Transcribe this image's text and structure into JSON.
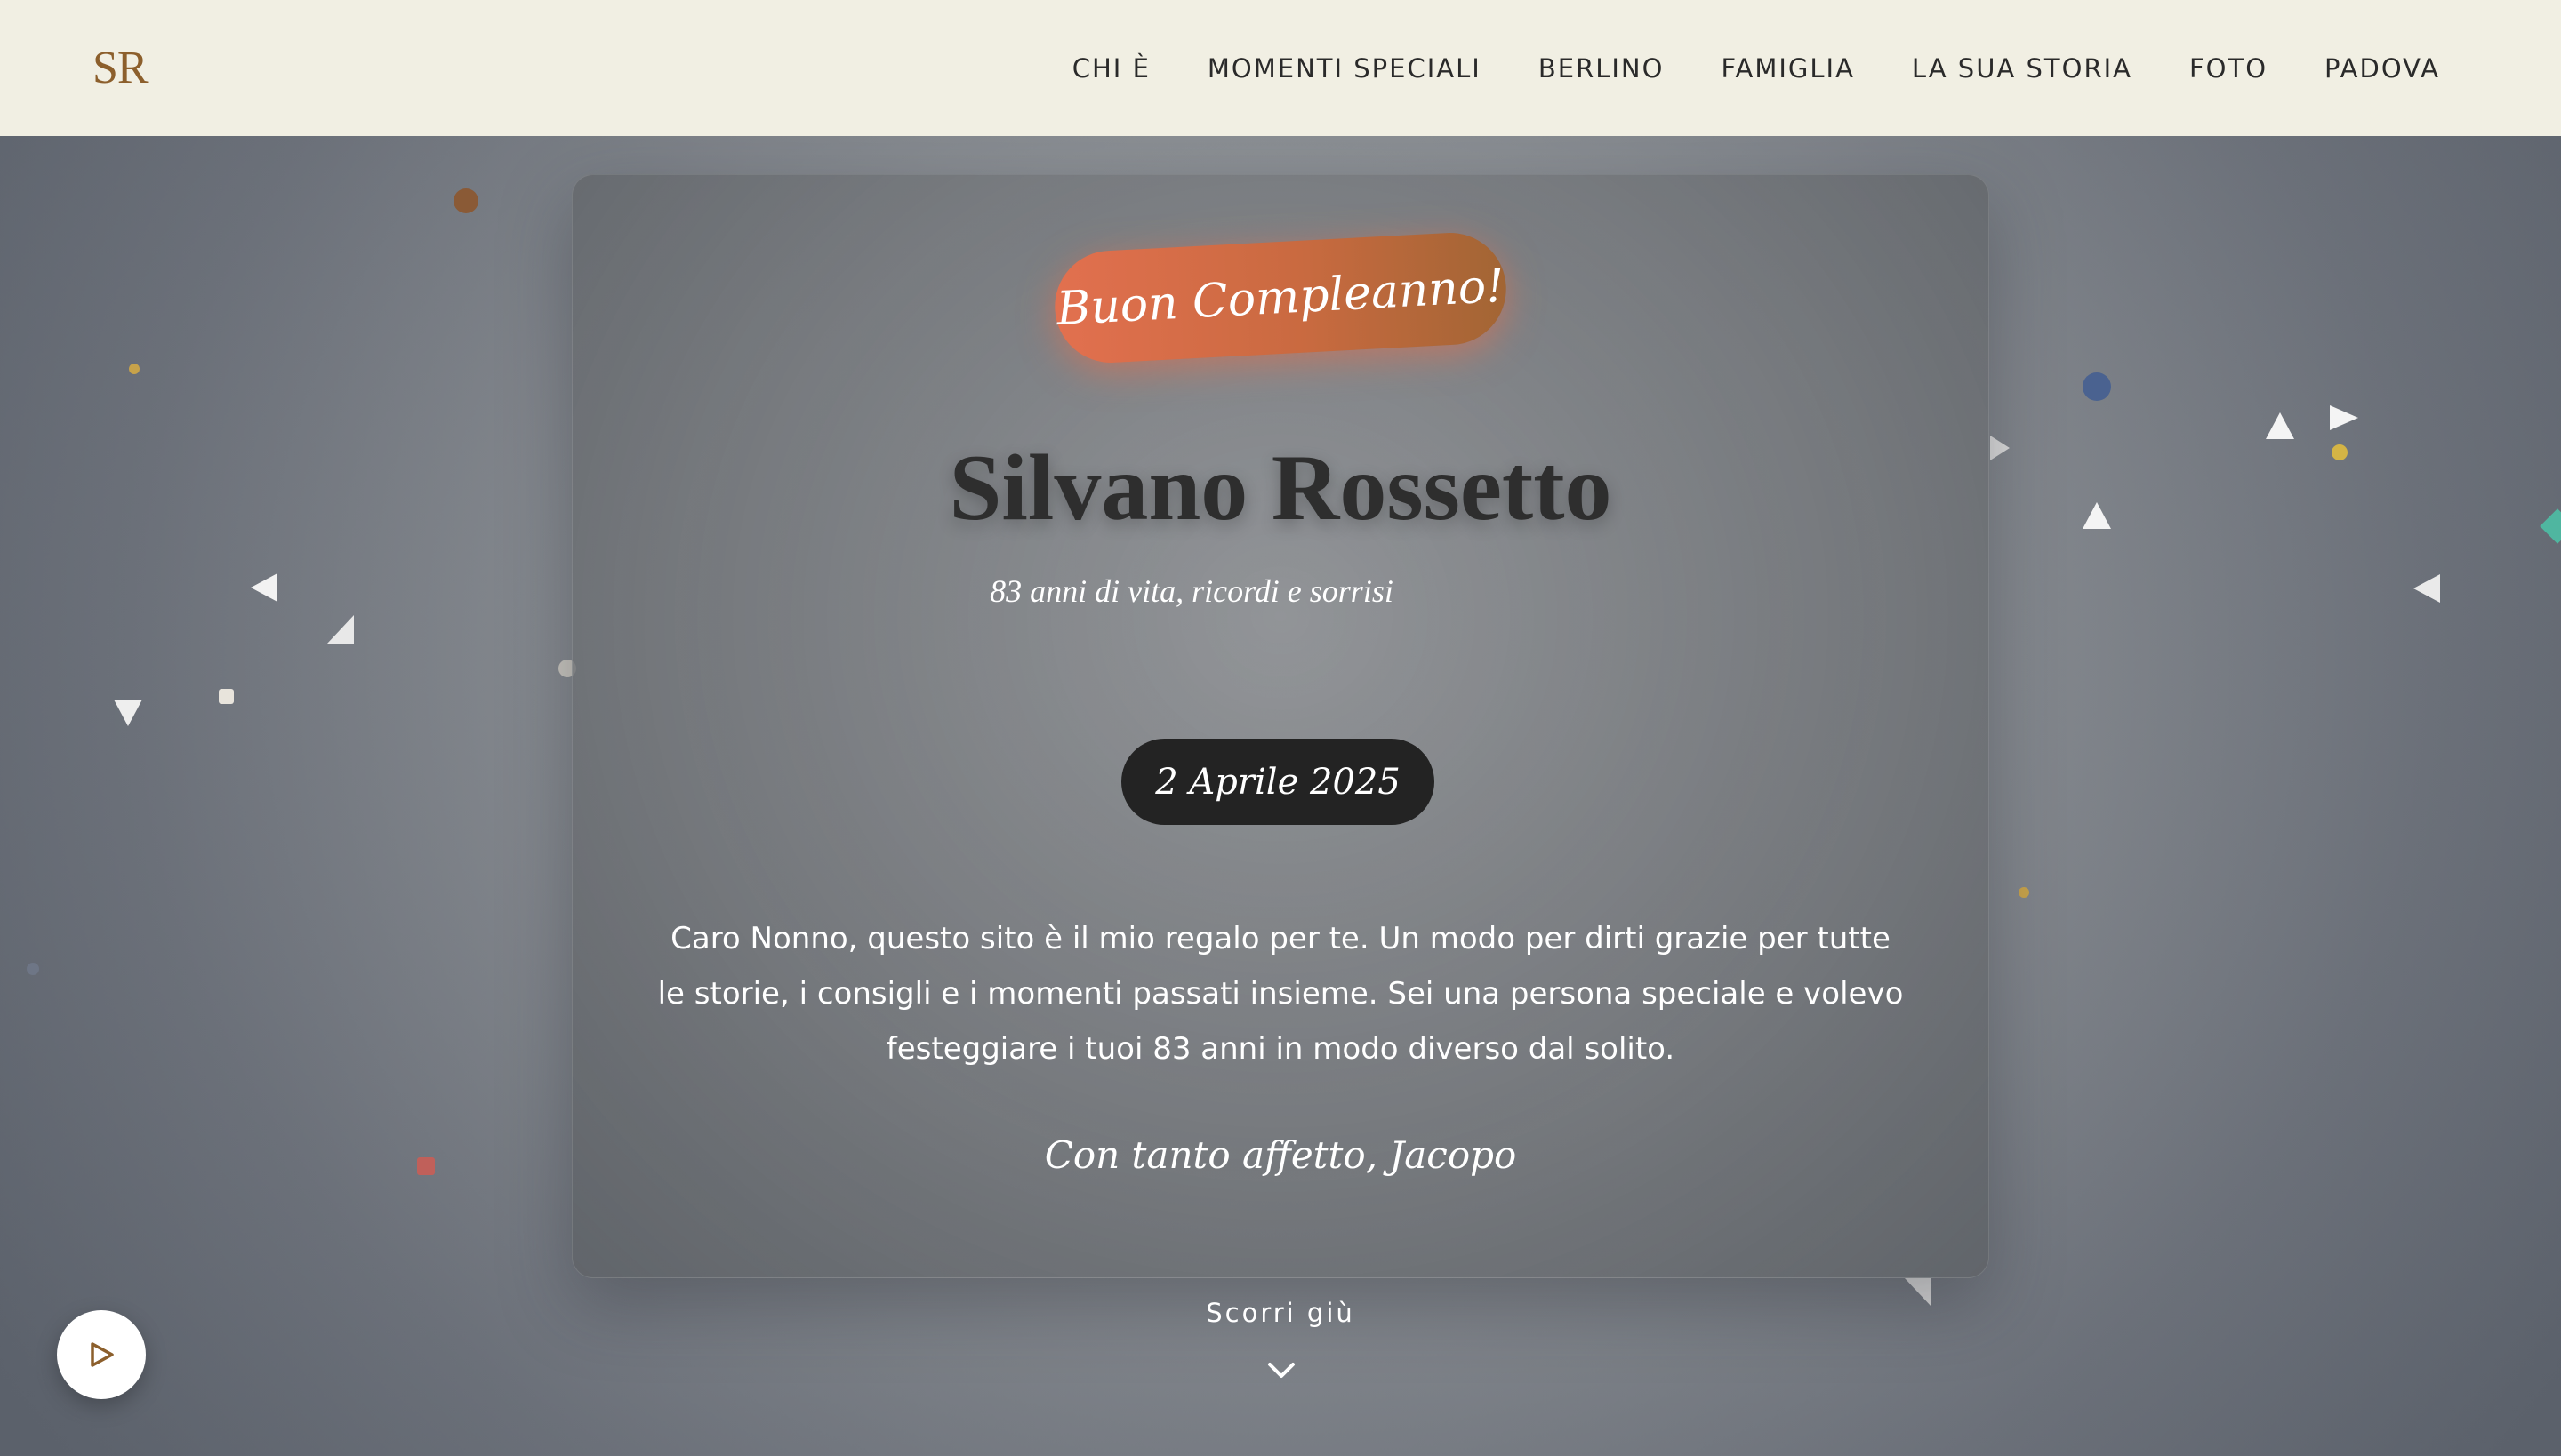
{
  "nav": {
    "logo": "SR",
    "links": [
      "CHI È",
      "MOMENTI SPECIALI",
      "BERLINO",
      "FAMIGLIA",
      "LA SUA STORIA",
      "FOTO",
      "PADOVA"
    ]
  },
  "hero": {
    "badge": "Buon Compleanno!",
    "name": "Silvano Rossetto",
    "subtitle": "83 anni di vita, ricordi e sorrisi",
    "date": "2 Aprile 2025",
    "message": "Caro Nonno, questo sito è il mio regalo per te. Un modo per dirti grazie per tutte le storie, i consigli e i momenti passati insieme. Sei una persona speciale e volevo festeggiare i tuoi 83 anni in modo diverso dal solito.",
    "signature": "Con tanto affetto, Jacopo"
  },
  "scroll": {
    "label": "Scorri giù",
    "icon": "chevron-down-icon"
  },
  "player": {
    "icon": "play-icon"
  },
  "colors": {
    "nav_bg": "#f1efe3",
    "logo": "#8c5f2c",
    "badge_start": "#e2704f",
    "badge_end": "#a26534",
    "date_pill": "#232323"
  }
}
